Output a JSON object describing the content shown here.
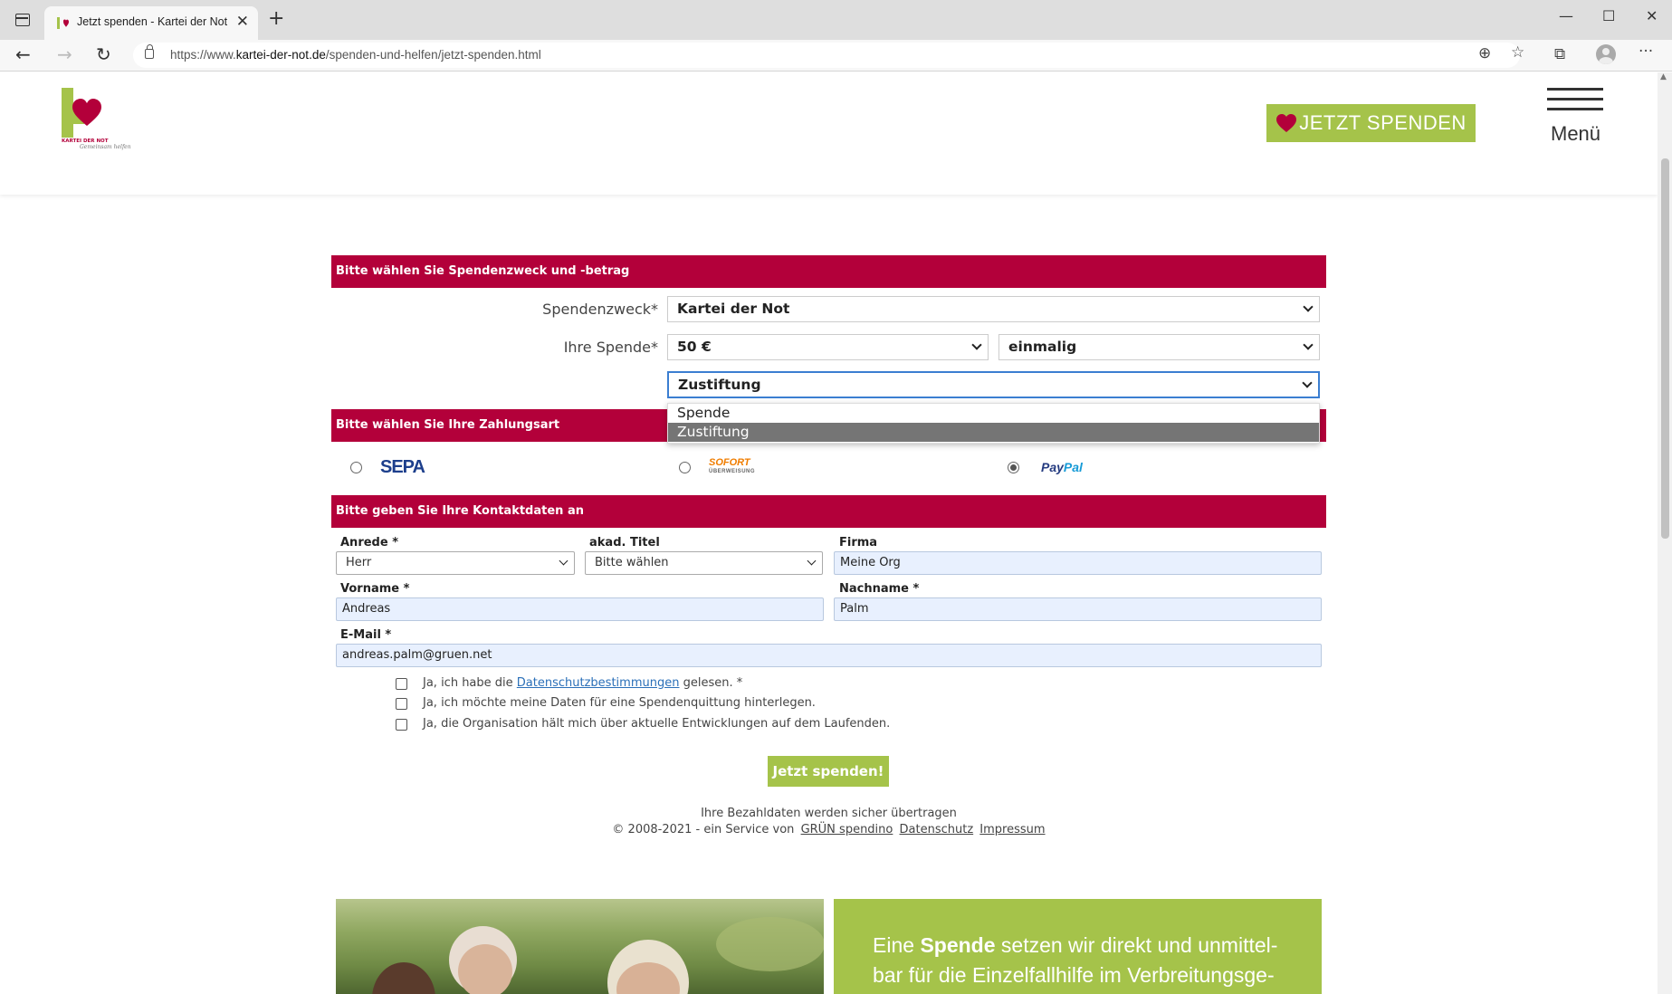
{
  "browser": {
    "tab_title": "Jetzt spenden - Kartei der Not",
    "url_prefix": "https://www.",
    "url_domain": "kartei-der-not.de",
    "url_path": "/spenden-und-helfen/jetzt-spenden.html"
  },
  "header": {
    "logo_text": "KARTEI DER NOT",
    "logo_signature": "Gemeinsam helfen",
    "donate_button": "JETZT SPENDEN",
    "menu_label": "Menü"
  },
  "section_purpose": {
    "title": "Bitte wählen Sie Spendenzweck und -betrag",
    "purpose_label": "Spendenzweck",
    "purpose_value": "Kartei der Not",
    "amount_label": "Ihre Spende",
    "amount_value": "50 €",
    "frequency_value": "einmalig",
    "type_value": "Zustiftung",
    "type_options": [
      "Spende",
      "Zustiftung"
    ],
    "required_mark": "*"
  },
  "section_payment": {
    "title": "Bitte wählen Sie Ihre Zahlungsart",
    "sepa_label": "SEPA",
    "sofort_label": "SOFORT",
    "sofort_sub": "ÜBERWEISUNG",
    "paypal_label_a": "Pay",
    "paypal_label_b": "Pal",
    "selected": "paypal"
  },
  "section_contact": {
    "title": "Bitte geben Sie Ihre Kontaktdaten an",
    "salutation_label": "Anrede *",
    "salutation_value": "Herr",
    "title_label": "akad. Titel",
    "title_value": "Bitte wählen",
    "company_label": "Firma",
    "company_value": "Meine Org",
    "firstname_label": "Vorname *",
    "firstname_value": "Andreas",
    "lastname_label": "Nachname *",
    "lastname_value": "Palm",
    "email_label": "E-Mail *",
    "email_value": "andreas.palm@gruen.net",
    "consent_1_pre": "Ja, ich habe die",
    "consent_1_link": "Datenschutzbestimmungen",
    "consent_1_post": "gelesen. *",
    "consent_2": "Ja, ich möchte meine Daten für eine Spendenquittung hinterlegen.",
    "consent_3": "Ja, die Organisation hält mich über aktuelle Entwicklungen auf dem Laufenden."
  },
  "submit_label": "Jetzt spenden!",
  "footer": {
    "secure_note": "Ihre Bezahldaten werden sicher übertragen",
    "copyright": "© 2008-2021 - ein Service von",
    "link_gruen": "GRÜN spendino",
    "link_privacy": "Datenschutz",
    "link_imprint": "Impressum"
  },
  "promo": {
    "text_pre": "Eine",
    "text_bold": "Spende",
    "text_post": "setzen wir direkt und unmittel-bar für die Einzelfallhilfe im Verbreitungsge-"
  },
  "colors": {
    "brand_red": "#b3003a",
    "brand_green": "#a5c34a",
    "input_autofill": "#e8f0fe"
  }
}
